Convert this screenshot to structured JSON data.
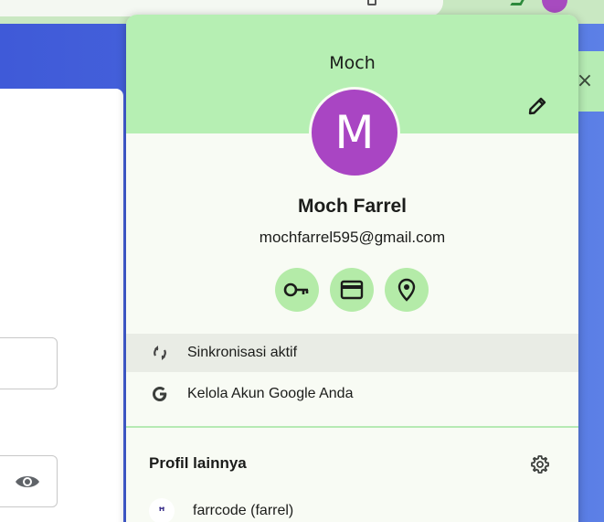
{
  "panel": {
    "header_name": "Moch",
    "avatar_letter": "M",
    "full_name": "Moch Farrel",
    "email": "mochfarrel595@gmail.com",
    "quick_actions": [
      {
        "icon": "key-icon",
        "label": "Passwords"
      },
      {
        "icon": "credit-card-icon",
        "label": "Payment methods"
      },
      {
        "icon": "location-pin-icon",
        "label": "Addresses"
      }
    ],
    "sync_label": "Sinkronisasi aktif",
    "manage_account_label": "Kelola Akun Google Anda",
    "other_profiles_title": "Profil lainnya",
    "other_profiles": [
      {
        "avatar_text": "ꟸ",
        "label": "farrcode (farrel)"
      }
    ]
  },
  "colors": {
    "header_bg": "#b6efb3",
    "avatar_bg": "#a945c3",
    "quick_action_bg": "#b4eba8",
    "page_bg": "#4a6bdc"
  },
  "background": {
    "toast_close": "×"
  }
}
